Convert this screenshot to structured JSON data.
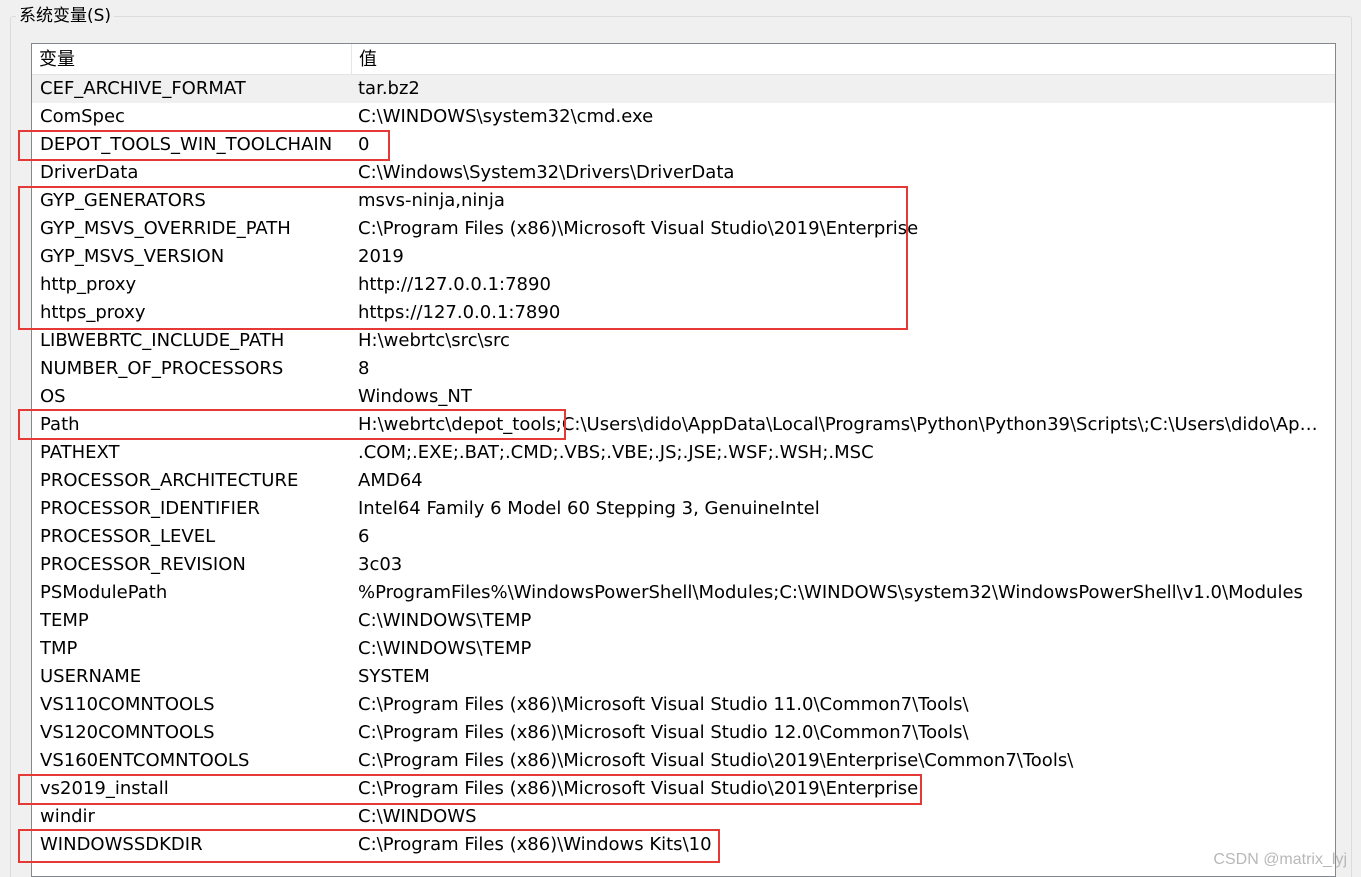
{
  "group_title": "系统变量(S)",
  "columns": {
    "name": "变量",
    "value": "值"
  },
  "rows": [
    {
      "name": "CEF_ARCHIVE_FORMAT",
      "value": "tar.bz2",
      "selected": true
    },
    {
      "name": "ComSpec",
      "value": "C:\\WINDOWS\\system32\\cmd.exe"
    },
    {
      "name": "DEPOT_TOOLS_WIN_TOOLCHAIN",
      "value": "0"
    },
    {
      "name": "DriverData",
      "value": "C:\\Windows\\System32\\Drivers\\DriverData"
    },
    {
      "name": "GYP_GENERATORS",
      "value": "msvs-ninja,ninja"
    },
    {
      "name": "GYP_MSVS_OVERRIDE_PATH",
      "value": "C:\\Program Files (x86)\\Microsoft Visual Studio\\2019\\Enterprise"
    },
    {
      "name": "GYP_MSVS_VERSION",
      "value": "2019"
    },
    {
      "name": "http_proxy",
      "value": "http://127.0.0.1:7890"
    },
    {
      "name": "https_proxy",
      "value": "https://127.0.0.1:7890"
    },
    {
      "name": "LIBWEBRTC_INCLUDE_PATH",
      "value": "H:\\webrtc\\src\\src"
    },
    {
      "name": "NUMBER_OF_PROCESSORS",
      "value": "8"
    },
    {
      "name": "OS",
      "value": "Windows_NT"
    },
    {
      "name": "Path",
      "value": "H:\\webrtc\\depot_tools;C:\\Users\\dido\\AppData\\Local\\Programs\\Python\\Python39\\Scripts\\;C:\\Users\\dido\\AppDa..."
    },
    {
      "name": "PATHEXT",
      "value": ".COM;.EXE;.BAT;.CMD;.VBS;.VBE;.JS;.JSE;.WSF;.WSH;.MSC"
    },
    {
      "name": "PROCESSOR_ARCHITECTURE",
      "value": "AMD64"
    },
    {
      "name": "PROCESSOR_IDENTIFIER",
      "value": "Intel64 Family 6 Model 60 Stepping 3, GenuineIntel"
    },
    {
      "name": "PROCESSOR_LEVEL",
      "value": "6"
    },
    {
      "name": "PROCESSOR_REVISION",
      "value": "3c03"
    },
    {
      "name": "PSModulePath",
      "value": "%ProgramFiles%\\WindowsPowerShell\\Modules;C:\\WINDOWS\\system32\\WindowsPowerShell\\v1.0\\Modules"
    },
    {
      "name": "TEMP",
      "value": "C:\\WINDOWS\\TEMP"
    },
    {
      "name": "TMP",
      "value": "C:\\WINDOWS\\TEMP"
    },
    {
      "name": "USERNAME",
      "value": "SYSTEM"
    },
    {
      "name": "VS110COMNTOOLS",
      "value": "C:\\Program Files (x86)\\Microsoft Visual Studio 11.0\\Common7\\Tools\\"
    },
    {
      "name": "VS120COMNTOOLS",
      "value": "C:\\Program Files (x86)\\Microsoft Visual Studio 12.0\\Common7\\Tools\\"
    },
    {
      "name": "VS160ENTCOMNTOOLS",
      "value": "C:\\Program Files (x86)\\Microsoft Visual Studio\\2019\\Enterprise\\Common7\\Tools\\"
    },
    {
      "name": "vs2019_install",
      "value": "C:\\Program Files (x86)\\Microsoft Visual Studio\\2019\\Enterprise"
    },
    {
      "name": "windir",
      "value": "C:\\WINDOWS"
    },
    {
      "name": "WINDOWSSDKDIR",
      "value": "C:\\Program Files (x86)\\Windows Kits\\10"
    }
  ],
  "highlight_color": "#e53935",
  "watermark": "CSDN @matrix_lyj"
}
